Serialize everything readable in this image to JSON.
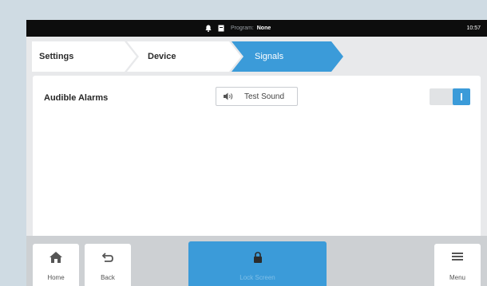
{
  "status_bar": {
    "program_label": "Program:",
    "program_value": "None",
    "time": "10:57"
  },
  "breadcrumb": {
    "items": [
      {
        "label": "Settings",
        "active": false
      },
      {
        "label": "Device",
        "active": false
      },
      {
        "label": "Signals",
        "active": true
      }
    ]
  },
  "settings": {
    "audible_alarms": {
      "label": "Audible Alarms",
      "test_button_label": "Test Sound",
      "enabled": true
    }
  },
  "bottom_bar": {
    "home_label": "Home",
    "back_label": "Back",
    "lock_label": "Lock Screen",
    "menu_label": "Menu"
  },
  "colors": {
    "accent": "#3b9bd9",
    "status_bar": "#0d0d0d",
    "page_background": "#cfdbe3"
  }
}
